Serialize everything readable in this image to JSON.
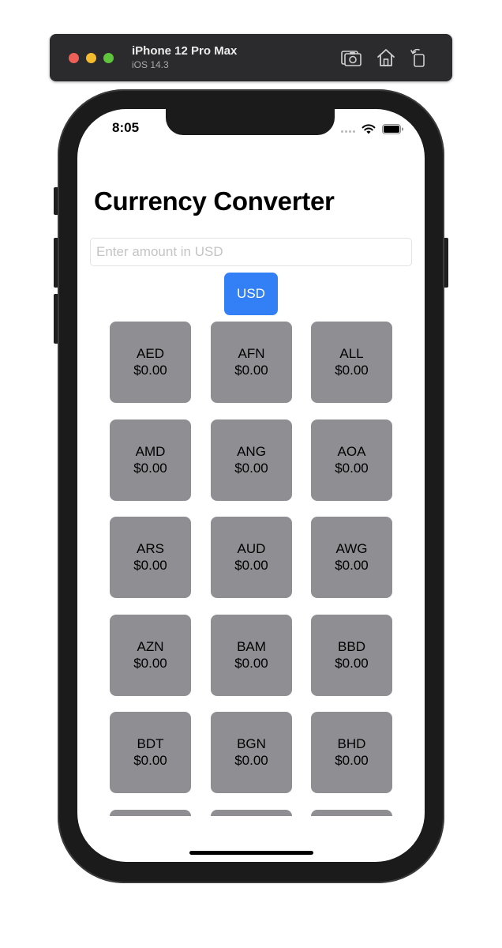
{
  "simulator": {
    "device_name": "iPhone 12 Pro Max",
    "os_version": "iOS 14.3",
    "buttons": [
      "screenshot-icon",
      "home-icon",
      "rotate-icon"
    ]
  },
  "status_bar": {
    "time": "8:05",
    "icons": [
      "cellular-icon",
      "wifi-icon",
      "battery-icon"
    ]
  },
  "app": {
    "title": "Currency Converter",
    "amount_input": {
      "value": "",
      "placeholder": "Enter amount in USD"
    },
    "base_currency_button": "USD",
    "accent_color": "#3380f6",
    "tile_color": "#8e8e93",
    "currencies": [
      {
        "code": "AED",
        "value": "$0.00"
      },
      {
        "code": "AFN",
        "value": "$0.00"
      },
      {
        "code": "ALL",
        "value": "$0.00"
      },
      {
        "code": "AMD",
        "value": "$0.00"
      },
      {
        "code": "ANG",
        "value": "$0.00"
      },
      {
        "code": "AOA",
        "value": "$0.00"
      },
      {
        "code": "ARS",
        "value": "$0.00"
      },
      {
        "code": "AUD",
        "value": "$0.00"
      },
      {
        "code": "AWG",
        "value": "$0.00"
      },
      {
        "code": "AZN",
        "value": "$0.00"
      },
      {
        "code": "BAM",
        "value": "$0.00"
      },
      {
        "code": "BBD",
        "value": "$0.00"
      },
      {
        "code": "BDT",
        "value": "$0.00"
      },
      {
        "code": "BGN",
        "value": "$0.00"
      },
      {
        "code": "BHD",
        "value": "$0.00"
      }
    ],
    "partially_visible_tiles": 3
  }
}
